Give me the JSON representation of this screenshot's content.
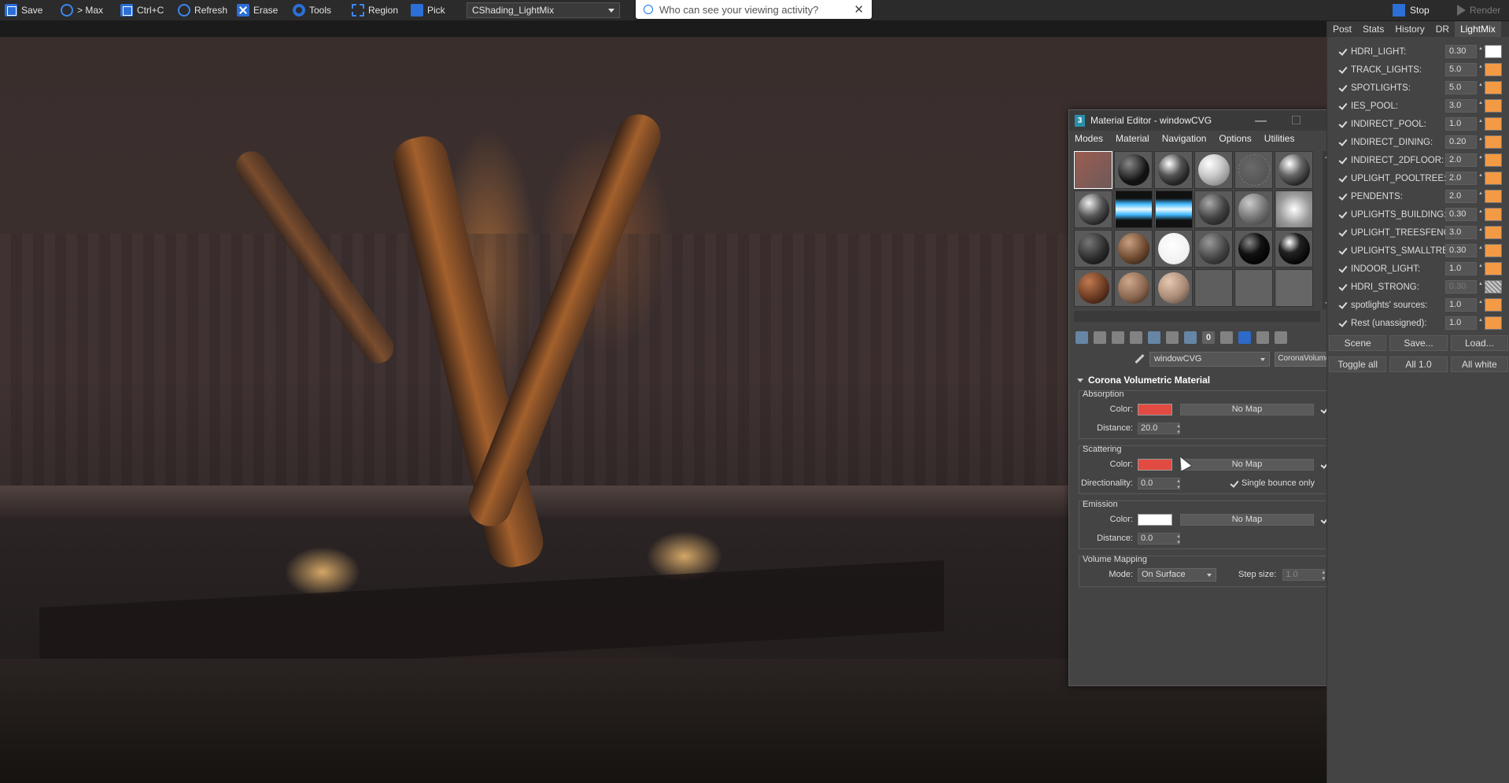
{
  "toolbar": {
    "buttons": [
      {
        "label": "Save",
        "icon": "save-icon"
      },
      {
        "label": "> Max",
        "icon": "refresh-to-max-icon"
      },
      {
        "label": "Ctrl+C",
        "icon": "copy-icon"
      },
      {
        "label": "Refresh",
        "icon": "refresh-icon"
      },
      {
        "label": "Erase",
        "icon": "erase-icon"
      },
      {
        "label": "Tools",
        "icon": "gear-icon"
      },
      {
        "label": "Region",
        "icon": "region-icon"
      },
      {
        "label": "Pick",
        "icon": "pick-icon"
      }
    ],
    "preset": "CShading_LightMix",
    "stop_label": "Stop",
    "render_label": "Render"
  },
  "privacy_popup": {
    "text": "Who can see your viewing activity?",
    "close": "✕"
  },
  "material_editor": {
    "title": "Material Editor - windowCVG",
    "logo": "3",
    "window_buttons": {
      "minimize": "—",
      "maximize": "☐",
      "close": "✕"
    },
    "menu": [
      "Modes",
      "Material",
      "Navigation",
      "Options",
      "Utilities"
    ],
    "material_name": "windowCVG",
    "material_type": "CoronaVolumeMtl",
    "rollout_title": "Corona Volumetric Material",
    "absorption": {
      "title": "Absorption",
      "color_label": "Color:",
      "color": "#e24b41",
      "map": "No Map",
      "distance_label": "Distance:",
      "distance": "20.0"
    },
    "scattering": {
      "title": "Scattering",
      "color_label": "Color:",
      "color": "#e24b41",
      "map": "No Map",
      "directionality_label": "Directionality:",
      "directionality": "0.0",
      "single_bounce_label": "Single bounce only"
    },
    "emission": {
      "title": "Emission",
      "color_label": "Color:",
      "color": "#ffffff",
      "map": "No Map",
      "distance_label": "Distance:",
      "distance": "0.0"
    },
    "volume_mapping": {
      "title": "Volume Mapping",
      "mode_label": "Mode:",
      "mode": "On Surface",
      "step_label": "Step size:",
      "step": "1.0"
    }
  },
  "right_panel": {
    "tabs": [
      "Post",
      "Stats",
      "History",
      "DR",
      "LightMix"
    ],
    "active_tab": "LightMix",
    "lights": [
      {
        "name": "HDRI_LIGHT:",
        "value": "0.30",
        "color": "#ffffff"
      },
      {
        "name": "TRACK_LIGHTS:",
        "value": "5.0",
        "color": "#f39a45"
      },
      {
        "name": "SPOTLIGHTS:",
        "value": "5.0",
        "color": "#f39a45"
      },
      {
        "name": "IES_POOL:",
        "value": "3.0",
        "color": "#f39a45"
      },
      {
        "name": "INDIRECT_POOL:",
        "value": "1.0",
        "color": "#f39a45"
      },
      {
        "name": "INDIRECT_DINING:",
        "value": "0.20",
        "color": "#f39a45"
      },
      {
        "name": "INDIRECT_2DFLOOR:",
        "value": "2.0",
        "color": "#f39a45"
      },
      {
        "name": "UPLIGHT_POOLTREE:",
        "value": "2.0",
        "color": "#f39a45"
      },
      {
        "name": "PENDENTS:",
        "value": "2.0",
        "color": "#f39a45"
      },
      {
        "name": "UPLIGHTS_BUILDING:",
        "value": "0.30",
        "color": "#f39a45"
      },
      {
        "name": "UPLIGHT_TREESFENCI",
        "value": "3.0",
        "color": "#f39a45"
      },
      {
        "name": "UPLIGHTS_SMALLTRE",
        "value": "0.30",
        "color": "#f39a45"
      },
      {
        "name": "INDOOR_LIGHT:",
        "value": "1.0",
        "color": "#f39a45"
      },
      {
        "name": "HDRI_STRONG:",
        "value": "0.30",
        "color": "hatch"
      },
      {
        "name": "spotlights' sources:",
        "value": "1.0",
        "color": "#f39a45"
      },
      {
        "name": "Rest (unassigned):",
        "value": "1.0",
        "color": "#f39a45"
      }
    ],
    "row1": [
      "Scene",
      "Save...",
      "Load..."
    ],
    "row2": [
      "Toggle all",
      "All 1.0",
      "All white"
    ]
  }
}
